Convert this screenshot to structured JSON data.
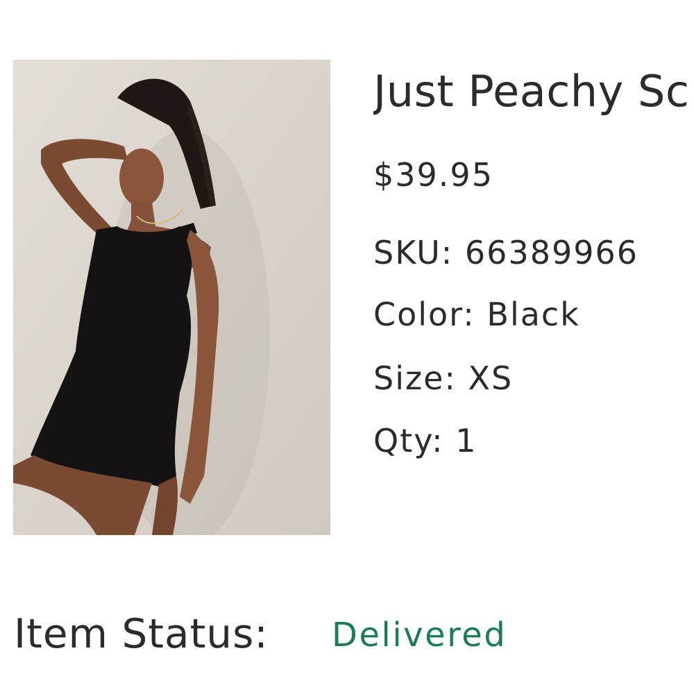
{
  "product": {
    "title": "Just Peachy Sc",
    "price": "$39.95",
    "image_alt": "model-wearing-black-mini-dress",
    "details": {
      "sku": "SKU: 66389966",
      "color": "Color: Black",
      "size": "Size: XS",
      "qty": "Qty: 1"
    }
  },
  "status": {
    "label": "Item Status:",
    "value": "Delivered",
    "value_color": "#1b7c5a"
  }
}
